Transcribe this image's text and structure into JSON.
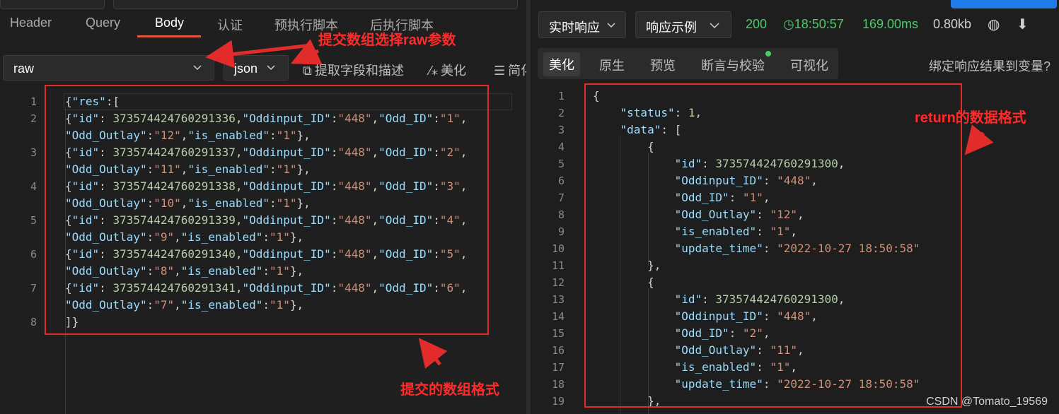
{
  "request": {
    "tabs": [
      "Header",
      "Query",
      "Body",
      "认证",
      "预执行脚本",
      "后执行脚本"
    ],
    "active_tab": "Body",
    "body_mode": "raw",
    "body_format": "json",
    "tools": {
      "extract": "提取字段和描述",
      "beautify": "美化",
      "simplify": "简化"
    },
    "line_numbers": [
      "1",
      "2",
      "3",
      "4",
      "5",
      "6",
      "7",
      "8"
    ]
  },
  "response": {
    "mode_select": "实时响应",
    "example_select": "响应示例",
    "status_code": "200",
    "time": "18:50:57",
    "duration": "169.00ms",
    "size": "0.80kb",
    "tabs": [
      "美化",
      "原生",
      "预览",
      "断言与校验",
      "可视化"
    ],
    "active_tab": "美化",
    "bind_link": "绑定响应结果到变量?",
    "line_numbers": [
      "1",
      "2",
      "3",
      "4",
      "5",
      "6",
      "7",
      "8",
      "9",
      "10",
      "11",
      "12",
      "13",
      "14",
      "15",
      "16",
      "17",
      "18",
      "19"
    ],
    "items": [
      {
        "id": "373574424760291300",
        "Oddinput_ID": "448",
        "Odd_ID": "1",
        "Odd_Outlay": "12",
        "is_enabled": "1",
        "update_time": "2022-10-27 18:50:58"
      },
      {
        "id": "373574424760291300",
        "Oddinput_ID": "448",
        "Odd_ID": "2",
        "Odd_Outlay": "11",
        "is_enabled": "1",
        "update_time": "2022-10-27 18:50:58"
      }
    ]
  },
  "annotations": {
    "raw_note": "提交数组选择raw参数",
    "submit_note": "提交的数组格式",
    "return_note": "return的数据格式"
  },
  "watermark": "CSDN @Tomato_19569",
  "colors": {
    "accent_tab": "#e5563f",
    "status_green": "#4ec96a",
    "annotation_red": "#e22b2b",
    "blue_button": "#1f7ce8"
  }
}
